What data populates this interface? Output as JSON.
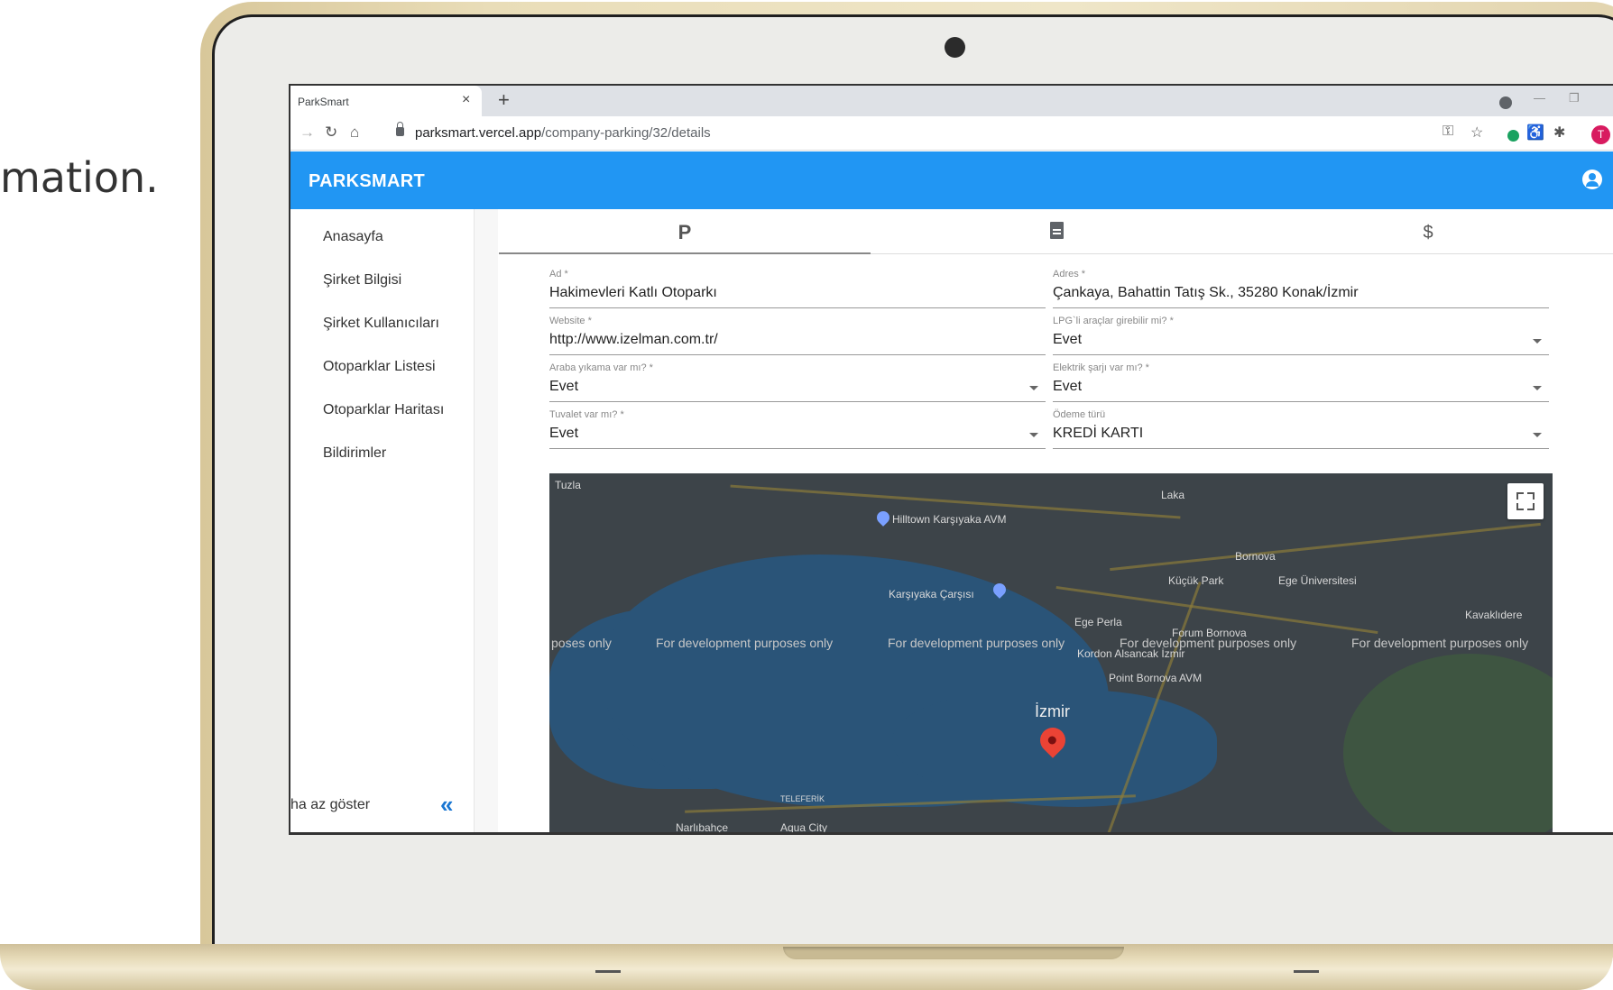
{
  "caption": "mation.",
  "browser": {
    "tab_title": "ParkSmart",
    "tab_close": "×",
    "new_tab": "+",
    "url_host": "parksmart.vercel.app",
    "url_path": "/company-parking/32/details",
    "avatar_letter": "T"
  },
  "app": {
    "brand": "PARKSMART"
  },
  "sidebar": {
    "items": [
      {
        "label": "Anasayfa"
      },
      {
        "label": "Şirket Bilgisi"
      },
      {
        "label": "Şirket Kullanıcıları"
      },
      {
        "label": "Otoparklar Listesi"
      },
      {
        "label": "Otoparklar Haritası"
      },
      {
        "label": "Bildirimler"
      }
    ],
    "footer": "ha az göster",
    "collapse_glyph": "«"
  },
  "tabs": {
    "parking": "P",
    "payment": "$"
  },
  "form": {
    "name": {
      "label": "Ad *",
      "value": "Hakimevleri Katlı Otoparkı"
    },
    "address": {
      "label": "Adres *",
      "value": "Çankaya, Bahattin Tatış Sk., 35280 Konak/İzmir"
    },
    "website": {
      "label": "Website *",
      "value": "http://www.izelman.com.tr/"
    },
    "lpg": {
      "label": "LPG`li araçlar girebilir mi? *",
      "value": "Evet"
    },
    "car_wash": {
      "label": "Araba yıkama var mı? *",
      "value": "Evet"
    },
    "ev_charge": {
      "label": "Elektrik şarjı var mı? *",
      "value": "Evet"
    },
    "toilet": {
      "label": "Tuvalet var mı? *",
      "value": "Evet"
    },
    "payment_type": {
      "label": "Ödeme türü",
      "value": "KREDİ KARTI"
    }
  },
  "map": {
    "watermark": "For development purposes only",
    "watermark_partial": "poses only",
    "labels": {
      "tuzla": "Tuzla",
      "laka": "Laka",
      "hilltown": "Hilltown Karşıyaka AVM",
      "bornova": "Bornova",
      "kucuk_park": "Küçük Park",
      "ege_uni": "Ege Üniversitesi",
      "karsiyaka": "Karşıyaka Çarşısı",
      "ege_perla": "Ege Perla",
      "forum": "Forum Bornova",
      "kordon": "Kordon Alsancak İzmir",
      "point": "Point Bornova AVM",
      "kavaklidere": "Kavaklıdere",
      "izmir": "İzmir",
      "teleferik": "TELEFERİK",
      "narlidere": "Narlıbahçe",
      "aqua": "Aqua City"
    }
  }
}
